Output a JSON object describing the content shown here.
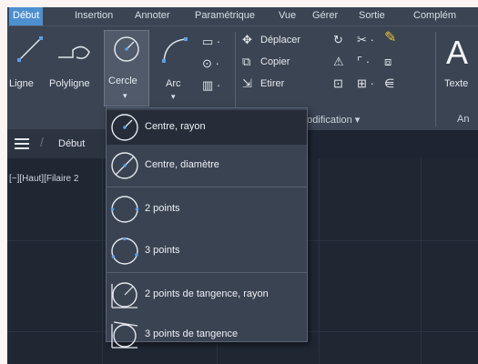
{
  "menu": {
    "tabs": [
      "Début",
      "Insertion",
      "Annoter",
      "Paramétrique",
      "Vue",
      "Gérer",
      "Sortie",
      "Complém"
    ],
    "active_tab": "Début"
  },
  "ribbon": {
    "draw": {
      "ligne": "Ligne",
      "polyligne": "Polyligne",
      "cercle": "Cercle",
      "arc": "Arc"
    },
    "modify": {
      "deplacer": "Déplacer",
      "copier": "Copier",
      "etirer": "Etirer",
      "panel_title": "Modification ▾"
    },
    "annotation": {
      "texte": "Texte",
      "panel_title": "An"
    }
  },
  "docbar": {
    "tab": "Début"
  },
  "viewport": {
    "label": "[−][Haut][Filaire 2"
  },
  "circle_menu": {
    "items": [
      {
        "label": "Centre, rayon",
        "icon": "circle-center-radius-icon"
      },
      {
        "label": "Centre, diamètre",
        "icon": "circle-center-diameter-icon"
      },
      {
        "label": "2 points",
        "icon": "circle-2-points-icon"
      },
      {
        "label": "3 points",
        "icon": "circle-3-points-icon"
      },
      {
        "label": "2 points de tangence, rayon",
        "icon": "circle-tan-tan-radius-icon"
      },
      {
        "label": "3 points de tangence",
        "icon": "circle-tan-tan-tan-icon"
      }
    ],
    "highlighted_index": 0
  },
  "colors": {
    "ribbon_bg": "#3b4453",
    "active_tab": "#4e8fd0",
    "canvas_bg": "#1f2733",
    "menu_bg": "#3a4352",
    "menu_highlight": "#262d39",
    "accent_yellow": "#e7c23a"
  }
}
